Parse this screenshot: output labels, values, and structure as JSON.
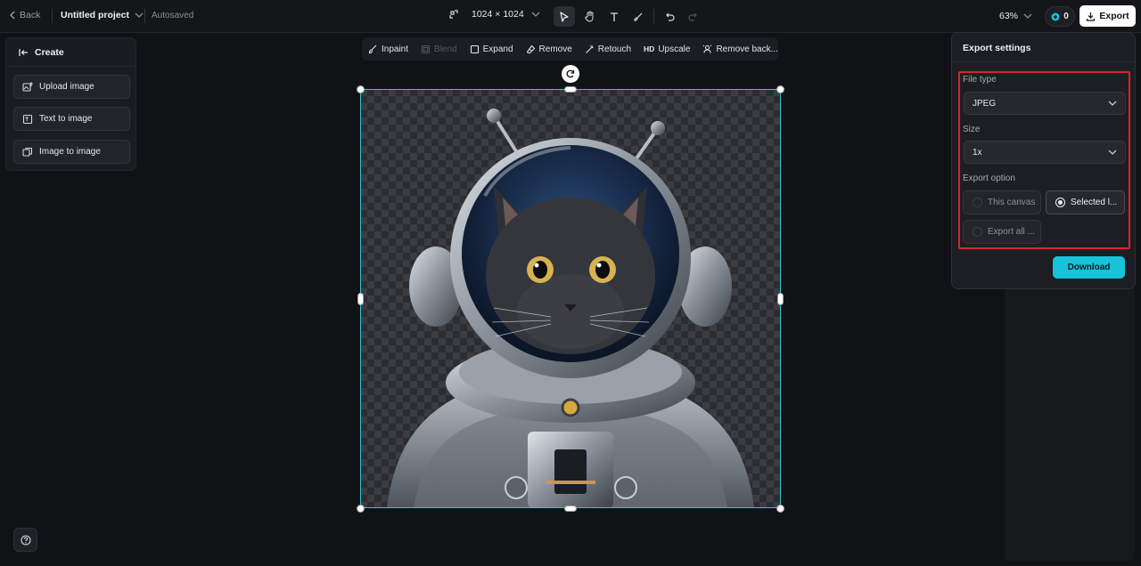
{
  "topbar": {
    "back_label": "Back",
    "project_name": "Untitled project",
    "save_status": "Autosaved",
    "canvas_size": "1024 × 1024",
    "zoom": "63%",
    "credits": "0",
    "export_label": "Export"
  },
  "create_panel": {
    "title": "Create",
    "items": [
      {
        "label": "Upload image",
        "icon": "upload-image-icon"
      },
      {
        "label": "Text to image",
        "icon": "text-to-image-icon"
      },
      {
        "label": "Image to image",
        "icon": "image-to-image-icon"
      }
    ]
  },
  "edit_toolbar": {
    "items": [
      {
        "label": "Inpaint",
        "enabled": true
      },
      {
        "label": "Blend",
        "enabled": false
      },
      {
        "label": "Expand",
        "enabled": true
      },
      {
        "label": "Remove",
        "enabled": true
      },
      {
        "label": "Retouch",
        "enabled": true
      },
      {
        "label": "Upscale",
        "icon_text": "HD",
        "enabled": true
      },
      {
        "label": "Remove back...",
        "enabled": true
      }
    ]
  },
  "export_settings": {
    "title": "Export settings",
    "file_type_label": "File type",
    "file_type_value": "JPEG",
    "size_label": "Size",
    "size_value": "1x",
    "export_option_label": "Export option",
    "options": [
      {
        "label": "This canvas",
        "selected": false
      },
      {
        "label": "Selected l...",
        "selected": true
      },
      {
        "label": "Export all ...",
        "selected": false
      }
    ],
    "download_label": "Download"
  },
  "colors": {
    "accent": "#16c3d9",
    "selection": "#2ec7cf",
    "highlight_box": "#d9252c"
  }
}
